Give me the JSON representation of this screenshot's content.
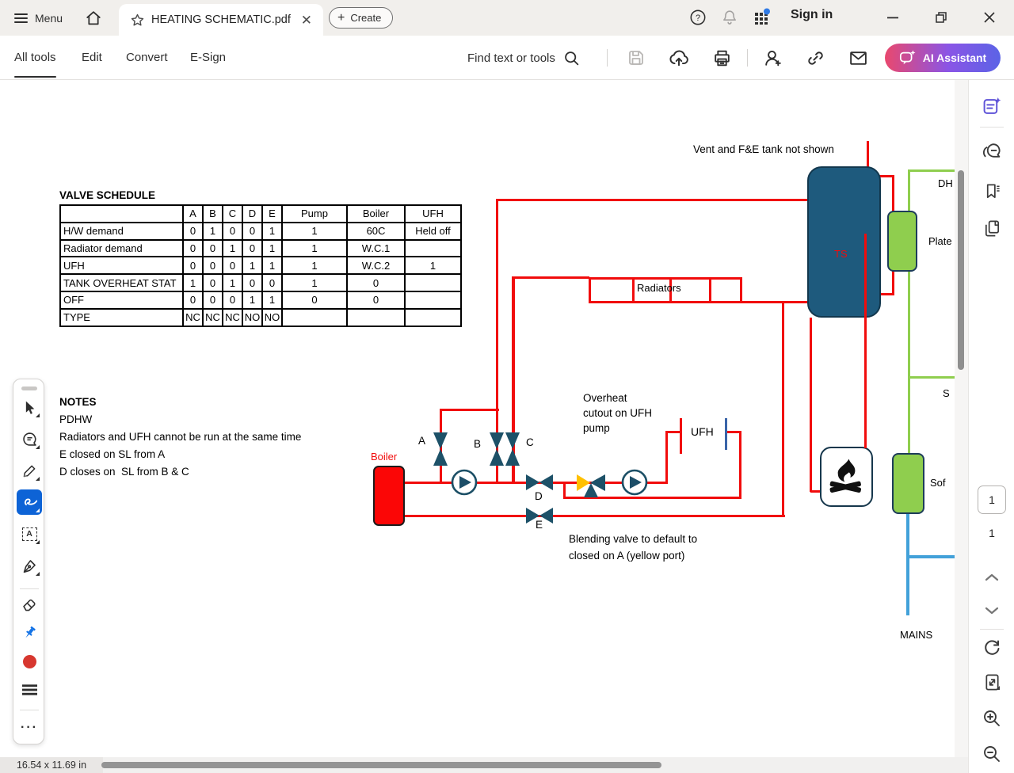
{
  "titlebar": {
    "menu_label": "Menu",
    "tab_title": "HEATING SCHEMATIC.pdf",
    "create_label": "Create",
    "sign_in_label": "Sign in"
  },
  "toolbar": {
    "tabs": [
      "All tools",
      "Edit",
      "Convert",
      "E-Sign"
    ],
    "find_label": "Find text or tools",
    "ai_assistant_label": "AI Assistant"
  },
  "right_panel": {
    "current_page": "1",
    "total_pages": "1"
  },
  "statusbar": {
    "page_size": "16.54 x 11.69 in"
  },
  "document": {
    "valve_schedule": {
      "title": "VALVE SCHEDULE",
      "headers": [
        "",
        "A",
        "B",
        "C",
        "D",
        "E",
        "Pump",
        "Boiler",
        "UFH"
      ],
      "rows": [
        [
          "H/W demand",
          "0",
          "1",
          "0",
          "0",
          "1",
          "1",
          "60C",
          "Held off"
        ],
        [
          "Radiator demand",
          "0",
          "0",
          "1",
          "0",
          "1",
          "1",
          "W.C.1",
          ""
        ],
        [
          "UFH",
          "0",
          "0",
          "0",
          "1",
          "1",
          "1",
          "W.C.2",
          "1"
        ],
        [
          "TANK OVERHEAT STAT",
          "1",
          "0",
          "1",
          "0",
          "0",
          "1",
          "0",
          ""
        ],
        [
          "OFF",
          "0",
          "0",
          "0",
          "1",
          "1",
          "0",
          "0",
          ""
        ],
        [
          "TYPE",
          "NC",
          "NC",
          "NC",
          "NO",
          "NO",
          "",
          "",
          ""
        ]
      ]
    },
    "notes": {
      "title": "NOTES",
      "lines": [
        "PDHW",
        "Radiators and UFH cannot be run at the same time",
        "E closed on SL from A",
        "D closes on  SL from B & C"
      ]
    },
    "labels": {
      "vent_note": "Vent and F&E tank not shown",
      "ts": "TS",
      "radiators": "Radiators",
      "overheat_note": "Overheat cutout on UFH pump",
      "ufh": "UFH",
      "boiler": "Boiler",
      "blending_note": "Blending valve to default to closed on A (yellow port)",
      "mains": "MAINS",
      "dh": "DH",
      "plate": "Plate",
      "s": "S",
      "sof": "Sof",
      "valve_a": "A",
      "valve_b": "B",
      "valve_c": "C",
      "valve_d": "D",
      "valve_e": "E"
    },
    "colors": {
      "pipe_red": "#f10c0c",
      "tank_teal": "#1e5a7d",
      "component_green": "#8fce4e",
      "mains_blue": "#42a1d9",
      "valve_teal": "#1d5168",
      "yellow_port": "#ffc000"
    }
  },
  "ui_colors": {
    "selected_tool_blue": "#0d63d6",
    "pin_blue": "#1473e6",
    "record_red": "#d7372f",
    "panel_purple": "#5f53d8",
    "ai_gradient_start": "#e9486e",
    "ai_gradient_end": "#5b63e6"
  }
}
